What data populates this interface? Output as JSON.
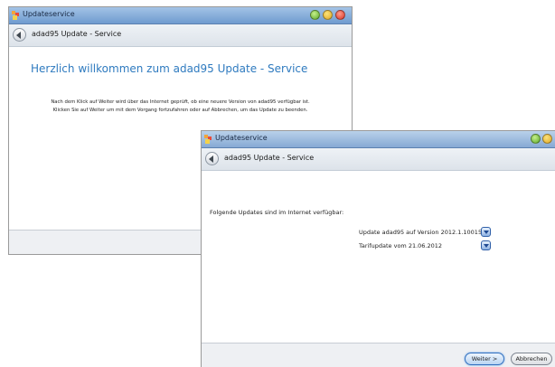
{
  "window1": {
    "title": "Updateservice",
    "nav_title": "adad95 Update - Service",
    "welcome_heading": "Herzlich willkommen zum adad95 Update - Service",
    "description_line1": "Nach dem Klick auf Weiter wird über das Internet geprüft, ob eine neuere Version von adad95 verfügbar ist.",
    "description_line2": "Klicken Sie auf Weiter um mit dem Vorgang fortzufahren oder auf Abbrechen, um das Update zu beenden."
  },
  "window2": {
    "title": "Updateservice",
    "nav_title": "adad95 Update - Service",
    "updates_label": "Folgende Updates sind im Internet verfügbar:",
    "updates": [
      {
        "label": "Update adad95 auf Version 2012.1.10015",
        "icon": "download-icon"
      },
      {
        "label": "Tarifupdate vom 21.06.2012",
        "icon": "download-icon"
      }
    ],
    "next_button": "Weiter >",
    "cancel_button": "Abbrechen"
  },
  "colors": {
    "heading_blue": "#2e7abf",
    "titlebar_blue": "#6f9bcf"
  }
}
